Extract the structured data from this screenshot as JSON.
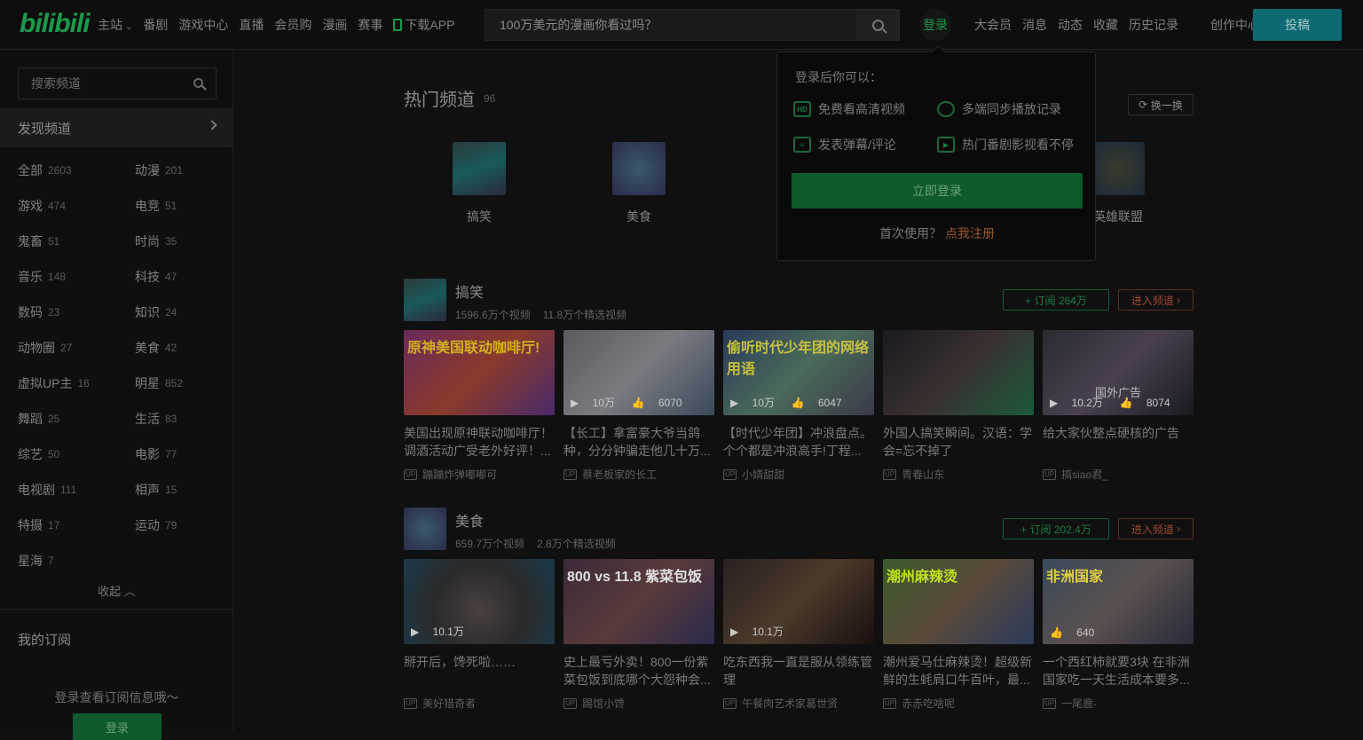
{
  "header": {
    "logo": "bilibili",
    "nav": [
      {
        "label": "主站"
      },
      {
        "label": "番剧"
      },
      {
        "label": "游戏中心"
      },
      {
        "label": "直播"
      },
      {
        "label": "会员购"
      },
      {
        "label": "漫画"
      },
      {
        "label": "赛事"
      },
      {
        "label": "下载APP"
      }
    ],
    "search_placeholder": "100万美元的漫画你看过吗？",
    "login": "登录",
    "right_nav": [
      "大会员",
      "消息",
      "动态",
      "收藏",
      "历史记录",
      "创作中心"
    ],
    "upload": "投稿"
  },
  "sidebar": {
    "search_placeholder": "搜索频道",
    "discover": "发现频道",
    "categories": [
      {
        "name": "全部",
        "count": "2603"
      },
      {
        "name": "动漫",
        "count": "201"
      },
      {
        "name": "游戏",
        "count": "474"
      },
      {
        "name": "电竞",
        "count": "51"
      },
      {
        "name": "鬼畜",
        "count": "51"
      },
      {
        "name": "时尚",
        "count": "35"
      },
      {
        "name": "音乐",
        "count": "148"
      },
      {
        "name": "科技",
        "count": "47"
      },
      {
        "name": "数码",
        "count": "23"
      },
      {
        "name": "知识",
        "count": "24"
      },
      {
        "name": "动物圈",
        "count": "27"
      },
      {
        "name": "美食",
        "count": "42"
      },
      {
        "name": "虚拟UP主",
        "count": "16"
      },
      {
        "name": "明星",
        "count": "852"
      },
      {
        "name": "舞蹈",
        "count": "25"
      },
      {
        "name": "生活",
        "count": "83"
      },
      {
        "name": "综艺",
        "count": "50"
      },
      {
        "name": "电影",
        "count": "77"
      },
      {
        "name": "电视剧",
        "count": "111"
      },
      {
        "name": "相声",
        "count": "15"
      },
      {
        "name": "特摄",
        "count": "17"
      },
      {
        "name": "运动",
        "count": "79"
      },
      {
        "name": "星海",
        "count": "7"
      }
    ],
    "collapse": "收起",
    "my_subs": "我的订阅",
    "sub_hint": "登录查看订阅信息哦～",
    "login_btn": "登录"
  },
  "main": {
    "hot_title": "热门频道",
    "hot_count": "96",
    "refresh": "换一换",
    "hot_channels": [
      {
        "name": "搞笑"
      },
      {
        "name": "美食"
      },
      {
        "name": "英雄联盟"
      }
    ],
    "sections": [
      {
        "name": "搞笑",
        "videos_count": "1596.6万个视频",
        "featured_count": "11.8万个精选视频",
        "subscribe": "+ 订阅 264万",
        "enter": "进入频道",
        "cards": [
          {
            "title": "美国出现原神联动咖啡厅！调酒活动广受老外好评！...",
            "uploader": "蹦蹦炸弹嘟嘟可",
            "views": "",
            "likes": "",
            "overlay": "原神美国联动咖啡厅!"
          },
          {
            "title": "【长工】拿富豪大爷当鸽种，分分钟骗走他几十万...",
            "uploader": "蔡老板家的长工",
            "views": "10万",
            "likes": "6070",
            "overlay": ""
          },
          {
            "title": "【时代少年团】冲浪盘点。个个都是冲浪高手!丁程...",
            "uploader": "小婧甜甜",
            "views": "10万",
            "likes": "6047",
            "overlay": "偷听时代少年团的网络用语"
          },
          {
            "title": "外国人搞笑瞬间。汉语：学会=忘不掉了",
            "uploader": "青春山东",
            "views": "",
            "likes": "",
            "overlay": ""
          },
          {
            "title": "给大家伙整点硬核的广告",
            "uploader": "搞siao君_",
            "views": "10.2万",
            "likes": "8074",
            "overlay": "",
            "center": "国外广告"
          }
        ]
      },
      {
        "name": "美食",
        "videos_count": "659.7万个视频",
        "featured_count": "2.8万个精选视频",
        "subscribe": "+ 订阅 202.4万",
        "enter": "进入频道",
        "cards": [
          {
            "title": "掰开后，馋死啦……",
            "uploader": "美好猎奇者",
            "views": "10.1万",
            "likes": "",
            "overlay": ""
          },
          {
            "title": "史上最亏外卖！800一份紫菜包饭到底哪个大怨种会...",
            "uploader": "踢馆小馋",
            "views": "",
            "likes": "",
            "overlay": "800 vs 11.8 紫菜包饭"
          },
          {
            "title": "吃东西我一直是服从领练管理",
            "uploader": "午餐肉艺术家葛世贤",
            "views": "10.1万",
            "likes": "",
            "overlay": ""
          },
          {
            "title": "潮州爱马仕麻辣烫！超级新鲜的生蚝肩口牛百叶，最...",
            "uploader": "赤赤吃啥呢",
            "views": "",
            "likes": "",
            "overlay": "潮州麻辣烫"
          },
          {
            "title": "一个西红柿就要3块 在非洲国家吃一天生活成本要多...",
            "uploader": "一尾鹿-",
            "views": "",
            "likes": "640",
            "overlay": "非洲国家"
          }
        ]
      }
    ]
  },
  "login_popover": {
    "title": "登录后你可以：",
    "features": [
      {
        "label": "免费看高清视频",
        "icon": "hd-icon"
      },
      {
        "label": "多端同步播放记录",
        "icon": "clock-icon"
      },
      {
        "label": "发表弹幕/评论",
        "icon": "danmaku-icon"
      },
      {
        "label": "热门番剧影视看不停",
        "icon": "play-icon"
      }
    ],
    "login_btn": "立即登录",
    "first_use": "首次使用？",
    "register": "点我注册"
  }
}
